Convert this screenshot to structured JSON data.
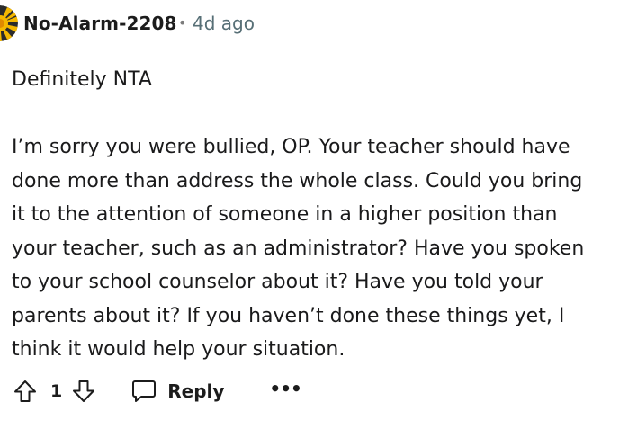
{
  "comment": {
    "author": "No-Alarm-2208",
    "separator": "•",
    "time_ago": "4d ago",
    "avatar_icon": "snoo-avatar-icon",
    "body_lines": [
      "Definitely NTA",
      "",
      "I’m sorry you were bullied, OP. Your teacher should have",
      "done more than address the whole class. Could you bring",
      "it to the attention of someone in a higher position than",
      "your teacher, such as an administrator? Have you spoken",
      "to your school counselor about it? Have you told your",
      "parents about it? If you haven’t done these things yet, I",
      "think it would help your situation."
    ]
  },
  "actions": {
    "upvote_icon": "upvote-arrow-icon",
    "score": "1",
    "downvote_icon": "downvote-arrow-icon",
    "reply_icon": "speech-bubble-icon",
    "reply_label": "Reply",
    "more_label": "•••"
  },
  "colors": {
    "text": "#1a1a1b",
    "meta": "#576f76",
    "avatar_yellow": "#f5b800",
    "avatar_dark": "#2b2b2b"
  }
}
